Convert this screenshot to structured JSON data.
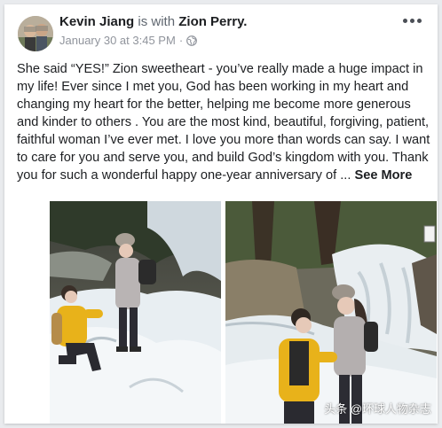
{
  "post": {
    "author": "Kevin Jiang",
    "with_text": "is with",
    "tagged": "Zion Perry.",
    "timestamp": "January 30 at 3:45 PM",
    "separator": "·",
    "privacy_icon": "globe-icon",
    "menu_icon": "more-options-icon",
    "body": "She said “YES!” Zion sweetheart - you’ve really made a huge impact in my life! Ever since I met you, God has been working in my heart and changing my heart for the better, helping me become more generous and kinder to others . You are the most kind, beautiful, forgiving, patient, faithful woman I’ve ever met. I love you more than words can say. I want to care for you and serve you, and build God’s kingdom with you. Thank you for such a wonderful happy one-year anniversary of ...",
    "see_more": "See More"
  },
  "photos": {
    "watermark": "头条 @环球人物杂志"
  },
  "colors": {
    "name": "#1c1e21",
    "meta": "#90949c",
    "jacket": "#e8b21a"
  }
}
